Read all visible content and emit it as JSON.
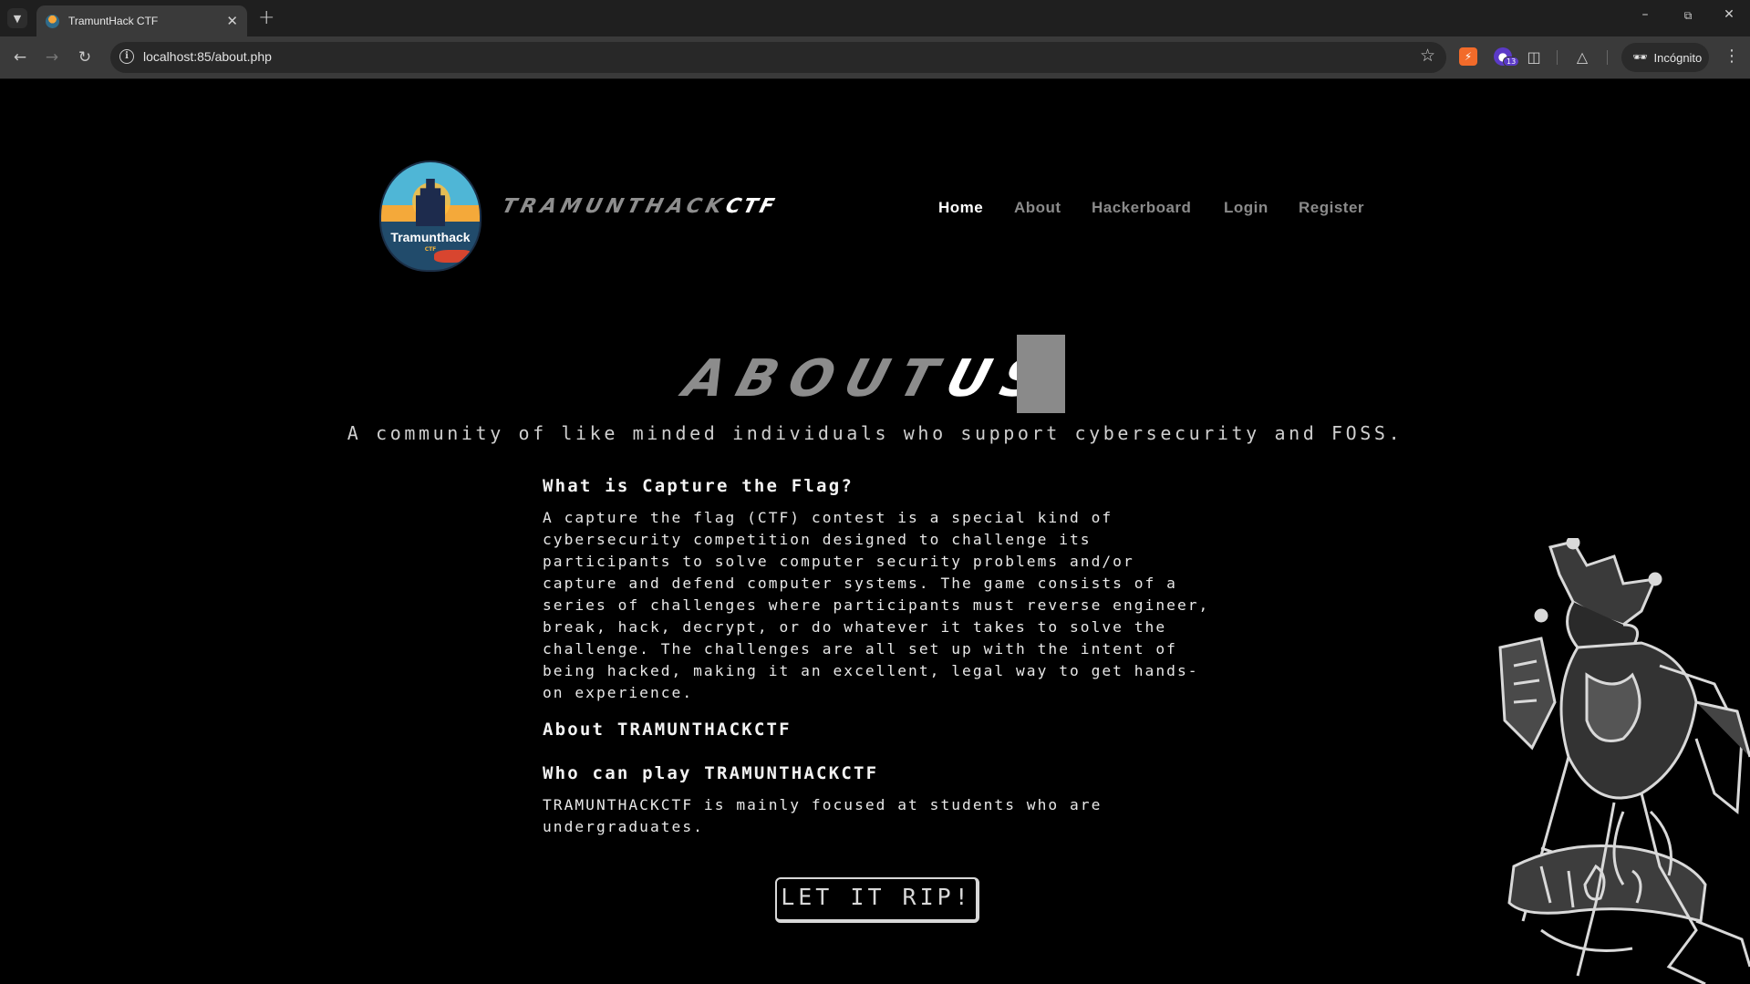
{
  "browser": {
    "tab_title": "TramuntHack CTF",
    "url": "localhost:85/about.php",
    "extension_badge": "13",
    "incognito_label": "Incógnito",
    "icons": [
      "tab-search-icon",
      "favicon",
      "close-icon",
      "plus-icon",
      "minimize-icon",
      "restore-icon",
      "close-window-icon",
      "back-arrow-icon",
      "forward-arrow-icon",
      "reload-icon",
      "site-info-icon",
      "bookmark-star-icon",
      "extension-icon",
      "puzzle-icon",
      "labs-flask-icon",
      "incognito-icon",
      "kebab-menu-icon"
    ]
  },
  "header": {
    "logo_text": "Tramunthack",
    "logo_sub": "CTF",
    "brand_main": "TRAMUNTHACK",
    "brand_accent": "CTF",
    "nav": [
      {
        "label": "Home",
        "active": true
      },
      {
        "label": "About",
        "active": false
      },
      {
        "label": "Hackerboard",
        "active": false
      },
      {
        "label": "Login",
        "active": false
      },
      {
        "label": "Register",
        "active": false
      }
    ]
  },
  "hero": {
    "title_main": "ABOUT",
    "title_accent": "US",
    "tagline": "A community of like minded individuals who support cybersecurity and FOSS."
  },
  "sections": [
    {
      "heading": "What is Capture the Flag?",
      "lines": [
        "A capture the flag (CTF) contest is a special kind of",
        "cybersecurity competition designed to challenge its",
        "participants to solve computer security problems and/or",
        "capture and defend computer systems. The game consists of a",
        "series of challenges where participants must reverse engineer,",
        "break, hack, decrypt, or do whatever it takes to solve the",
        "challenge. The challenges are all set up with the intent of",
        "being hacked, making it an excellent, legal way to get hands-",
        "on experience."
      ]
    },
    {
      "heading": "About TRAMUNTHACKCTF",
      "lines": []
    },
    {
      "heading": "Who can play TRAMUNTHACKCTF",
      "lines": [
        "TRAMUNTHACKCTF is mainly focused at students who are",
        "undergraduates."
      ]
    }
  ],
  "cta": {
    "label": "LET IT RIP!"
  },
  "colors": {
    "page_bg": "#000000",
    "muted_text": "#8a8a8a",
    "text": "#e8e8e8",
    "chrome_bg": "#1f1f1f",
    "toolbar_bg": "#3a3a3a"
  }
}
